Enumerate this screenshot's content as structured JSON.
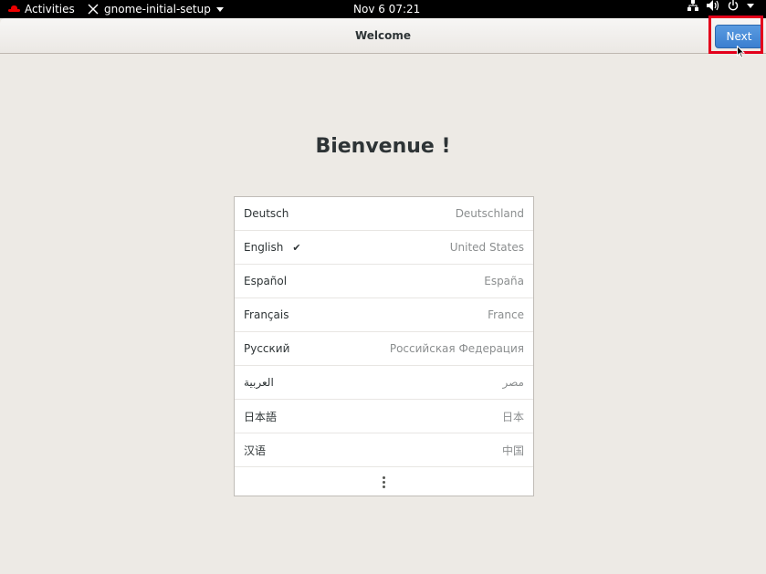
{
  "topbar": {
    "activities": "Activities",
    "app_name": "gnome-initial-setup",
    "clock": "Nov 6  07:21"
  },
  "headerbar": {
    "title": "Welcome",
    "next_label": "Next"
  },
  "welcome_heading": "Bienvenue !",
  "languages": [
    {
      "name": "Deutsch",
      "region": "Deutschland",
      "selected": false
    },
    {
      "name": "English",
      "region": "United States",
      "selected": true
    },
    {
      "name": "Español",
      "region": "España",
      "selected": false
    },
    {
      "name": "Français",
      "region": "France",
      "selected": false
    },
    {
      "name": "Русский",
      "region": "Российская Федерация",
      "selected": false
    },
    {
      "name": "العربية",
      "region": "مصر",
      "selected": false
    },
    {
      "name": "日本語",
      "region": "日本",
      "selected": false
    },
    {
      "name": "汉语",
      "region": "中国",
      "selected": false
    }
  ],
  "colors": {
    "accent": "#3b7fd0",
    "highlight": "#e3001b",
    "background": "#edeae5"
  }
}
